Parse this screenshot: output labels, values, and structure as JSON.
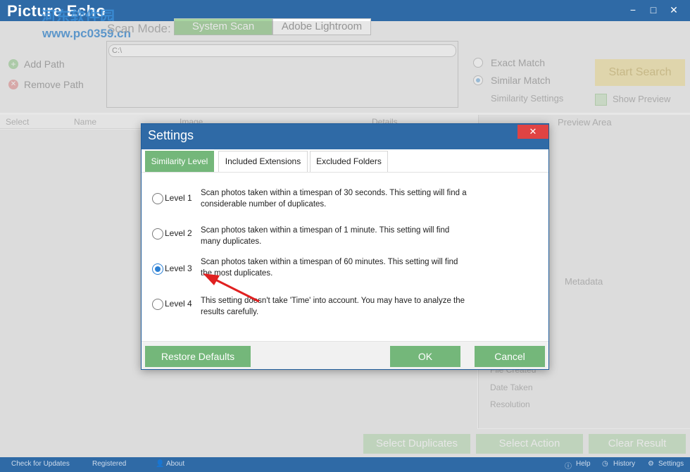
{
  "app": {
    "logo": "Picture Echo",
    "watermark": "河东软件园",
    "watermark_url": "www.pc0359.cn",
    "window_controls": {
      "minimize": "−",
      "maximize": "□",
      "close": "✕"
    }
  },
  "toolbar": {
    "scan_mode_label": "Scan Mode:",
    "scan_tabs": [
      "System Scan",
      "Adobe Lightroom"
    ],
    "path_value": "C:\\",
    "add_path": "Add Path",
    "remove_path": "Remove Path",
    "match_options": [
      "Exact Match",
      "Similar Match"
    ],
    "selected_match": "Similar Match",
    "similarity_settings": "Similarity Settings",
    "start_search": "Start Search",
    "show_preview": "Show Preview"
  },
  "list": {
    "columns": [
      "Select",
      "Name",
      "Image",
      "Details"
    ]
  },
  "right_panel": {
    "preview_area": "Preview Area",
    "metadata": "Metadata",
    "metadata_fields": [
      "File Created",
      "Date Taken",
      "Resolution"
    ]
  },
  "actions": [
    "Select Duplicates",
    "Select Action",
    "Clear Result"
  ],
  "statusbar": {
    "left": [
      "Check for Updates",
      "Registered",
      "About"
    ],
    "right": [
      "Help",
      "History",
      "Settings"
    ]
  },
  "dialog": {
    "title": "Settings",
    "close": "✕",
    "tabs": [
      "Similarity Level",
      "Included Extensions",
      "Excluded Folders"
    ],
    "active_tab": "Similarity Level",
    "levels": [
      {
        "label": "Level 1",
        "desc": "Scan photos taken within a timespan of 30 seconds. This setting will find a considerable number of duplicates."
      },
      {
        "label": "Level 2",
        "desc": "Scan photos taken within a timespan of 1 minute. This setting will find many duplicates."
      },
      {
        "label": "Level 3",
        "desc": "Scan photos taken within a timespan of 60 minutes. This setting will find the most duplicates."
      },
      {
        "label": "Level 4",
        "desc": "This setting doesn't take 'Time' into account. You may have to analyze the results carefully."
      }
    ],
    "selected_level": "Level 3",
    "buttons": {
      "restore": "Restore Defaults",
      "ok": "OK",
      "cancel": "Cancel"
    }
  },
  "colors": {
    "titlebar": "#2f6aa6",
    "accent_green": "#74b77a",
    "close_red": "#e04343",
    "annotation_arrow": "#e02020"
  }
}
